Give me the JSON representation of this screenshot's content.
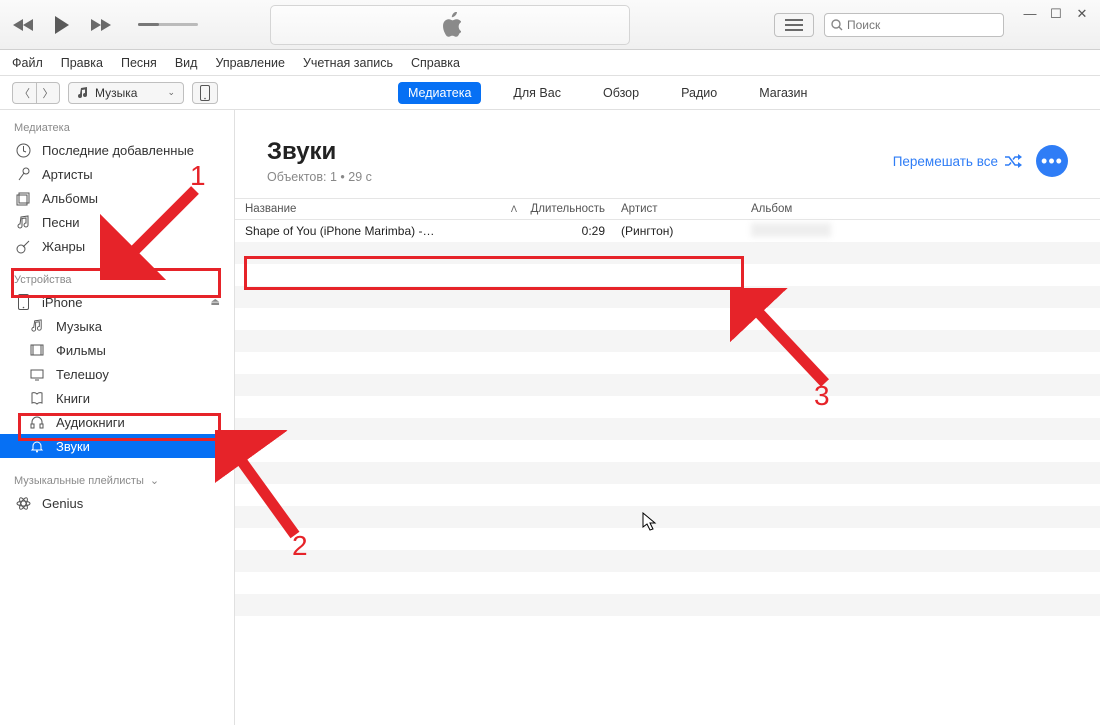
{
  "search_placeholder": "Поиск",
  "menu": [
    "Файл",
    "Правка",
    "Песня",
    "Вид",
    "Управление",
    "Учетная запись",
    "Справка"
  ],
  "picker": {
    "label": "Музыка"
  },
  "tabs": [
    {
      "label": "Медиатека",
      "active": true
    },
    {
      "label": "Для Вас"
    },
    {
      "label": "Обзор"
    },
    {
      "label": "Радио"
    },
    {
      "label": "Магазин"
    }
  ],
  "sidebar": {
    "library_header": "Медиатека",
    "library": [
      {
        "label": "Последние добавленные",
        "icon": "clock"
      },
      {
        "label": "Артисты",
        "icon": "mic"
      },
      {
        "label": "Альбомы",
        "icon": "album"
      },
      {
        "label": "Песни",
        "icon": "note"
      },
      {
        "label": "Жанры",
        "icon": "guitar"
      }
    ],
    "devices_header": "Устройства",
    "device": {
      "label": "iPhone",
      "icon": "phone"
    },
    "device_children": [
      {
        "label": "Музыка",
        "icon": "note"
      },
      {
        "label": "Фильмы",
        "icon": "film"
      },
      {
        "label": "Телешоу",
        "icon": "tv"
      },
      {
        "label": "Книги",
        "icon": "book"
      },
      {
        "label": "Аудиокниги",
        "icon": "headphones"
      },
      {
        "label": "Звуки",
        "icon": "bell",
        "selected": true
      }
    ],
    "playlists_header": "Музыкальные плейлисты",
    "playlists": [
      {
        "label": "Genius",
        "icon": "atom"
      }
    ]
  },
  "content": {
    "title": "Звуки",
    "subtitle": "Объектов: 1 • 29 с",
    "shuffle": "Перемешать все",
    "columns": {
      "name": "Название",
      "duration": "Длительность",
      "artist": "Артист",
      "album": "Альбом"
    },
    "rows": [
      {
        "name": "Shape of You (iPhone Marimba) -…",
        "duration": "0:29",
        "artist": "(Рингтон)",
        "album": ""
      }
    ]
  },
  "annotations": {
    "n1": "1",
    "n2": "2",
    "n3": "3"
  }
}
